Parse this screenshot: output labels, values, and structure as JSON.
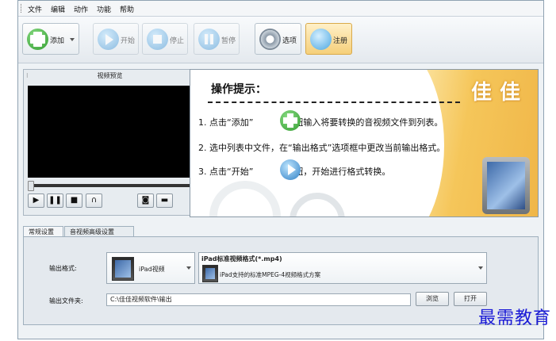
{
  "menu": {
    "items": [
      "文件",
      "编辑",
      "动作",
      "功能",
      "帮助"
    ]
  },
  "toolbar": {
    "add": "添加",
    "start": "开始",
    "stop": "停止",
    "pause": "暂停",
    "options": "选项",
    "register": "注册"
  },
  "player": {
    "title": "视频预览"
  },
  "tips": {
    "heading": "操作提示：",
    "brand": "佳佳",
    "line1_a": "1. 点击“添加”",
    "line1_b": "按钮输入将要转换的音视频文件到列表。",
    "line2": "2. 选中列表中文件，在“输出格式”选项框中更改当前输出格式。",
    "line3_a": "3. 点击“开始”",
    "line3_b": "按钮，开始进行格式转换。"
  },
  "tabs": [
    "常规设置",
    "音视频高级设置"
  ],
  "settings": {
    "output_format_label": "输出格式:",
    "device": "iPad视频",
    "format_title": "iPad标准视频格式(*.mp4)",
    "format_desc": "iPad支持的标准MPEG-4视频格式方案",
    "output_folder_label": "输出文件夹:",
    "output_folder": "C:\\佳佳视频软件\\输出",
    "browse": "浏览",
    "open": "打开"
  },
  "watermark": "最需教育"
}
